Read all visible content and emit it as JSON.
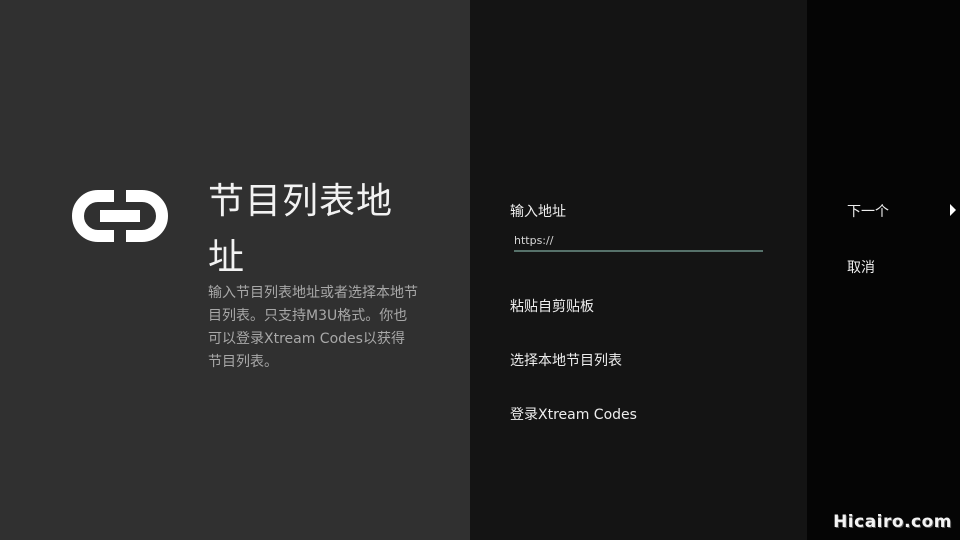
{
  "info": {
    "icon": "link-icon",
    "title": "节目列表地址",
    "description": "输入节目列表地址或者选择本地节目列表。只支持M3U格式。你也可以登录Xtream Codes以获得节目列表。"
  },
  "form": {
    "field_label": "输入地址",
    "url_value": "https://",
    "actions": {
      "paste": "粘贴自剪贴板",
      "local": "选择本地节目列表",
      "xtream": "登录Xtream Codes"
    }
  },
  "nav": {
    "next_label": "下一个",
    "next_icon": "triangle-right-icon",
    "cancel_label": "取消"
  },
  "watermark": "Hicairo.com",
  "colors": {
    "left_panel": "#303030",
    "mid_panel": "#141414",
    "right_panel": "#050505",
    "input_underline": "#56716a"
  }
}
